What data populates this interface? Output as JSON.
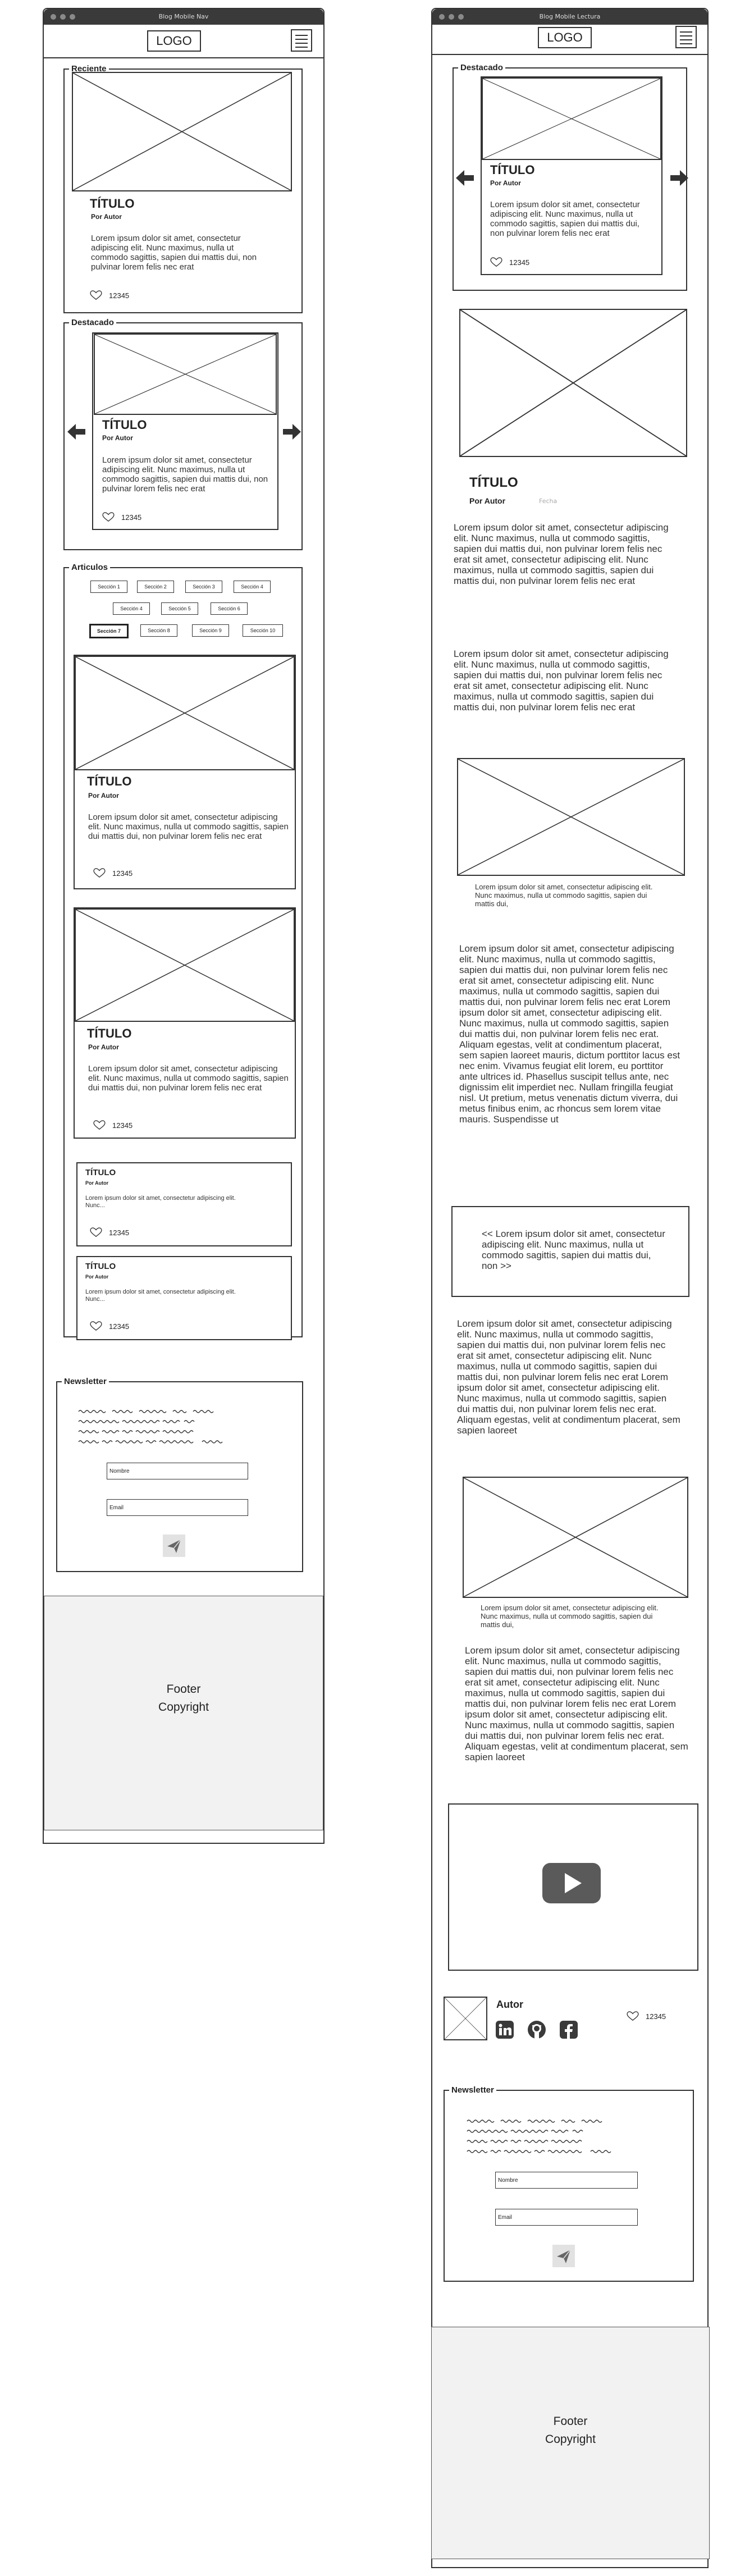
{
  "home": {
    "window_title": "Blog Mobile Nav",
    "logo": "LOGO",
    "recent": {
      "legend": "Reciente",
      "title": "TÍTULO",
      "author": "Por Autor",
      "excerpt": "Lorem ipsum dolor sit amet, consectetur adipiscing elit. Nunc maximus, nulla ut commodo sagittis, sapien dui mattis dui, non pulvinar lorem felis nec erat",
      "likes": "12345"
    },
    "featured": {
      "legend": "Destacado",
      "title": "TÍTULO",
      "author": "Por Autor",
      "excerpt": "Lorem ipsum dolor sit amet, consectetur adipiscing elit. Nunc maximus, nulla ut commodo sagittis, sapien dui mattis dui, non pulvinar lorem felis nec erat",
      "likes": "12345"
    },
    "articles": {
      "legend": "Articulos",
      "tags": [
        "Sección 1",
        "Sección 2",
        "Sección 3",
        "Sección 4",
        "Sección 4",
        "Sección 5",
        "Sección 6",
        "Sección 7",
        "Sección 8",
        "Sección 9",
        "Sección 10"
      ],
      "active_tag": "Sección 7",
      "items": [
        {
          "title": "TÍTULO",
          "author": "Por Autor",
          "excerpt": "Lorem ipsum dolor sit amet, consectetur adipiscing elit. Nunc maximus, nulla ut commodo sagittis, sapien dui mattis dui, non pulvinar lorem felis nec erat",
          "likes": "12345"
        },
        {
          "title": "TÍTULO",
          "author": "Por Autor",
          "excerpt": "Lorem ipsum dolor sit amet, consectetur adipiscing elit. Nunc maximus, nulla ut commodo sagittis, sapien dui mattis dui, non pulvinar lorem felis nec erat",
          "likes": "12345"
        },
        {
          "title": "TÍTULO",
          "author": "Por Autor",
          "excerpt": "Lorem ipsum dolor sit amet, consectetur adipiscing elit. Nunc...",
          "likes": "12345"
        },
        {
          "title": "TÍTULO",
          "author": "Por Autor",
          "excerpt": "Lorem ipsum dolor sit amet, consectetur adipiscing elit. Nunc...",
          "likes": "12345"
        }
      ]
    },
    "newsletter": {
      "legend": "Newsletter",
      "name_placeholder": "Nombre",
      "email_placeholder": "Email"
    },
    "footer": {
      "line1": "Footer",
      "line2": "Copyright"
    }
  },
  "reading": {
    "window_title": "Blog Mobile Lectura",
    "logo": "LOGO",
    "featured": {
      "legend": "Destacado",
      "title": "TÍTULO",
      "author": "Por Autor",
      "excerpt": "Lorem ipsum dolor sit amet, consectetur adipiscing elit. Nunc maximus, nulla ut commodo sagittis, sapien dui mattis dui, non pulvinar lorem felis nec erat",
      "likes": "12345"
    },
    "article": {
      "title": "TÍTULO",
      "author": "Por Autor",
      "date": "Fecha",
      "para1": "Lorem ipsum dolor sit amet, consectetur adipiscing elit. Nunc maximus, nulla ut commodo sagittis, sapien dui mattis dui, non pulvinar lorem felis nec erat sit amet, consectetur adipiscing elit. Nunc maximus, nulla ut commodo sagittis, sapien dui mattis dui, non pulvinar lorem felis nec erat",
      "para2": "Lorem ipsum dolor sit amet, consectetur adipiscing elit. Nunc maximus, nulla ut commodo sagittis, sapien dui mattis dui, non pulvinar lorem felis nec erat sit amet, consectetur adipiscing elit. Nunc maximus, nulla ut commodo sagittis, sapien dui mattis dui, non pulvinar lorem felis nec erat",
      "caption1": "Lorem ipsum dolor sit amet, consectetur adipiscing elit. Nunc maximus, nulla ut commodo sagittis, sapien dui mattis dui,",
      "para3": "Lorem ipsum dolor sit amet, consectetur adipiscing elit. Nunc maximus, nulla ut commodo sagittis, sapien dui mattis dui, non pulvinar lorem felis nec erat sit amet, consectetur adipiscing elit. Nunc maximus, nulla ut commodo sagittis, sapien dui mattis dui, non pulvinar lorem felis nec erat Lorem ipsum dolor sit amet, consectetur adipiscing elit. Nunc maximus, nulla ut commodo sagittis, sapien dui mattis dui, non pulvinar lorem felis nec erat. Aliquam egestas, velit at condimentum placerat, sem sapien laoreet mauris, dictum porttitor lacus est nec enim. Vivamus feugiat elit lorem, eu porttitor ante ultrices id. Phasellus suscipit tellus ante, nec dignissim elit imperdiet nec. Nullam fringilla feugiat nisl. Ut pretium, metus venenatis dictum viverra, dui metus finibus enim, ac rhoncus sem lorem vitae mauris. Suspendisse ut",
      "quote": "<< Lorem ipsum dolor sit amet, consectetur adipiscing elit. Nunc maximus, nulla ut commodo sagittis, sapien dui mattis dui, non >>",
      "para4": "Lorem ipsum dolor sit amet, consectetur adipiscing elit. Nunc maximus, nulla ut commodo sagittis, sapien dui mattis dui, non pulvinar lorem felis nec erat sit amet, consectetur adipiscing elit. Nunc maximus, nulla ut commodo sagittis, sapien dui mattis dui, non pulvinar lorem felis nec erat Lorem ipsum dolor sit amet, consectetur adipiscing elit. Nunc maximus, nulla ut commodo sagittis, sapien dui mattis dui, non pulvinar lorem felis nec erat. Aliquam egestas, velit at condimentum placerat, sem sapien laoreet",
      "caption2": "Lorem ipsum dolor sit amet, consectetur adipiscing elit. Nunc maximus, nulla ut commodo sagittis, sapien dui mattis dui,",
      "para5": "Lorem ipsum dolor sit amet, consectetur adipiscing elit. Nunc maximus, nulla ut commodo sagittis, sapien dui mattis dui, non pulvinar lorem felis nec erat sit amet, consectetur adipiscing elit. Nunc maximus, nulla ut commodo sagittis, sapien dui mattis dui, non pulvinar lorem felis nec erat Lorem ipsum dolor sit amet, consectetur adipiscing elit. Nunc maximus, nulla ut commodo sagittis, sapien dui mattis dui, non pulvinar lorem felis nec erat. Aliquam egestas, velit at condimentum placerat, sem sapien laoreet"
    },
    "author_box": {
      "label": "Autor",
      "likes": "12345",
      "icons": [
        "linkedin-icon",
        "github-icon",
        "facebook-icon"
      ]
    },
    "newsletter": {
      "legend": "Newsletter",
      "name_placeholder": "Nombre",
      "email_placeholder": "Email"
    },
    "footer": {
      "line1": "Footer",
      "line2": "Copyright"
    }
  }
}
